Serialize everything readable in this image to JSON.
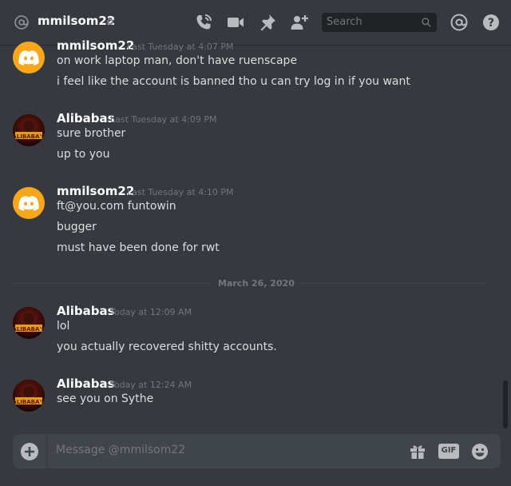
{
  "header": {
    "username": "mmilsom22",
    "search_placeholder": "Search"
  },
  "messages": [
    {
      "author": "mmilsom22",
      "timestamp": "Last Tuesday at 4:07 PM",
      "lines": [
        "on work laptop man, don't have ruenscape",
        "i feel like the account is banned tho u can try log in if you want"
      ]
    },
    {
      "author": "Alibabas",
      "timestamp": "Last Tuesday at 4:09 PM",
      "lines": [
        "sure brother",
        "up to you"
      ]
    },
    {
      "author": "mmilsom22",
      "timestamp": "Last Tuesday at 4:10 PM",
      "lines": [
        "ft@you.com funtowin",
        "bugger",
        "must have been done for rwt"
      ]
    },
    {
      "author": "Alibabas",
      "timestamp": "Today at 12:09 AM",
      "lines": [
        "lol",
        "you actually recovered shitty accounts."
      ]
    },
    {
      "author": "Alibabas",
      "timestamp": "Today at 12:24 AM",
      "lines": [
        "see you on Sythe"
      ]
    }
  ],
  "divider": "March 26, 2020",
  "avatar_text": "ALIBABA'S",
  "composer": {
    "placeholder": "Message @mmilsom22",
    "gif_label": "GIF"
  },
  "colors": {
    "background": "#36393f",
    "discord_avatar": "#faa61a",
    "status_offline": "#747f8d"
  }
}
